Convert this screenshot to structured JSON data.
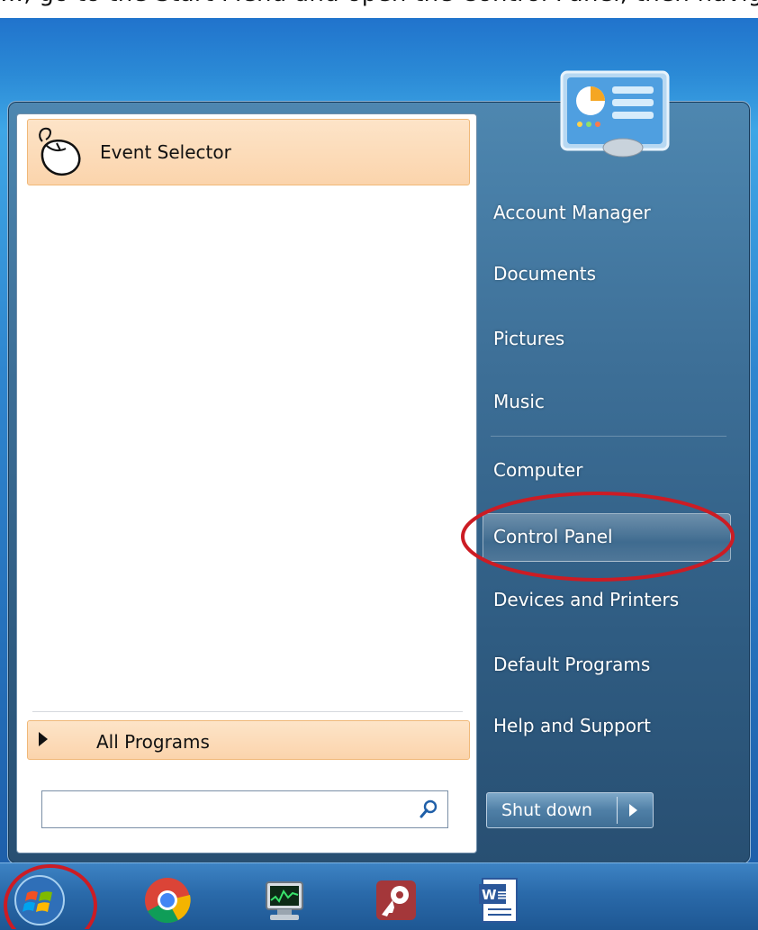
{
  "caption_text": "…, go to the Start Menu and open the Control Panel, then navigate to the following:",
  "start_menu": {
    "pinned_programs": [
      {
        "label": "Event Selector",
        "icon": "mouse-icon"
      }
    ],
    "all_programs_label": "All Programs",
    "search": {
      "value": "",
      "placeholder": ""
    },
    "right_pane_items": [
      {
        "label": "Account Manager"
      },
      {
        "label": "Documents"
      },
      {
        "label": "Pictures"
      },
      {
        "label": "Music"
      },
      {
        "label": "Computer"
      },
      {
        "label": "Control Panel",
        "highlighted": true
      },
      {
        "label": "Devices and Printers"
      },
      {
        "label": "Default Programs"
      },
      {
        "label": "Help and Support"
      }
    ],
    "shutdown_label": "Shut down"
  },
  "taskbar": {
    "items": [
      {
        "icon": "windows-start-orb-icon"
      },
      {
        "icon": "chrome-icon"
      },
      {
        "icon": "task-manager-monitor-icon"
      },
      {
        "icon": "access-key-icon"
      },
      {
        "icon": "word-document-icon"
      }
    ]
  },
  "annotations": {
    "color": "#cc1c24",
    "circled": [
      "Control Panel",
      "Start orb"
    ]
  }
}
